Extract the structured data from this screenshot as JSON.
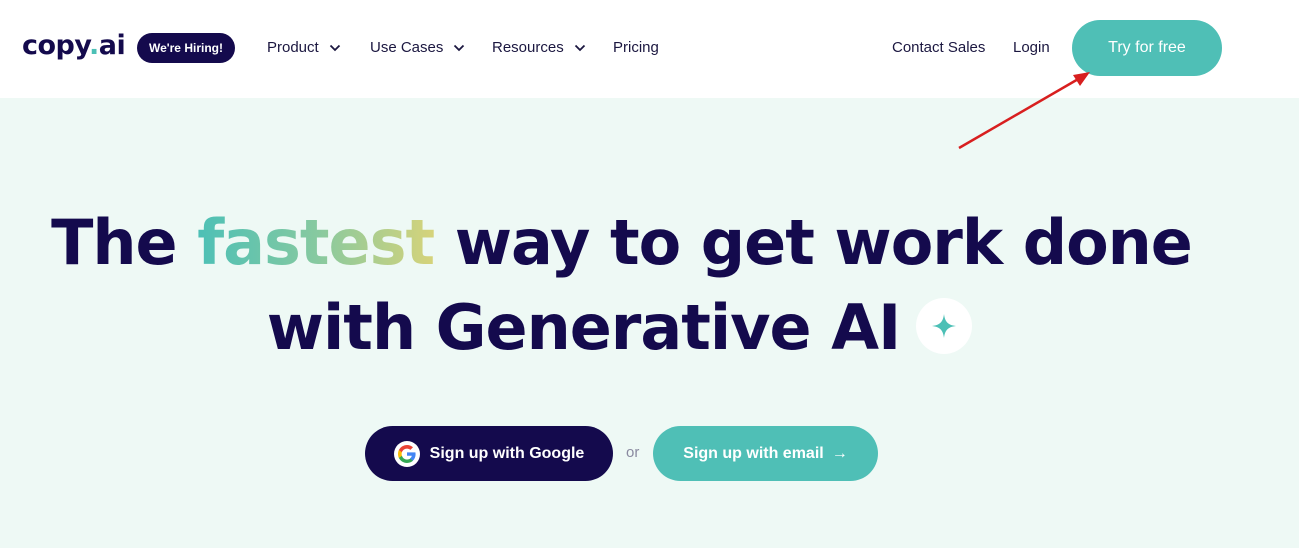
{
  "header": {
    "logo_main": "copy",
    "logo_dot": ".",
    "logo_suffix": "ai",
    "hiring_badge": "We're Hiring!",
    "nav": {
      "product": "Product",
      "use_cases": "Use Cases",
      "resources": "Resources",
      "pricing": "Pricing"
    },
    "contact_sales": "Contact Sales",
    "login": "Login",
    "try_free": "Try for free"
  },
  "hero": {
    "line1_prefix": "The",
    "line1_highlight": "fastest",
    "line1_suffix": "way to get work done",
    "line2": "with Generative AI"
  },
  "cta": {
    "google": "Sign up with Google",
    "or": "or",
    "email": "Sign up with email",
    "email_arrow": "→"
  },
  "colors": {
    "brand_navy": "#140a4d",
    "brand_teal": "#4fbfb6",
    "hero_bg": "#eef9f5",
    "annotation_arrow": "#d81f1f"
  },
  "icons": [
    "chevron-down-icon",
    "sparkle-icon",
    "google-icon",
    "arrow-right-icon"
  ]
}
